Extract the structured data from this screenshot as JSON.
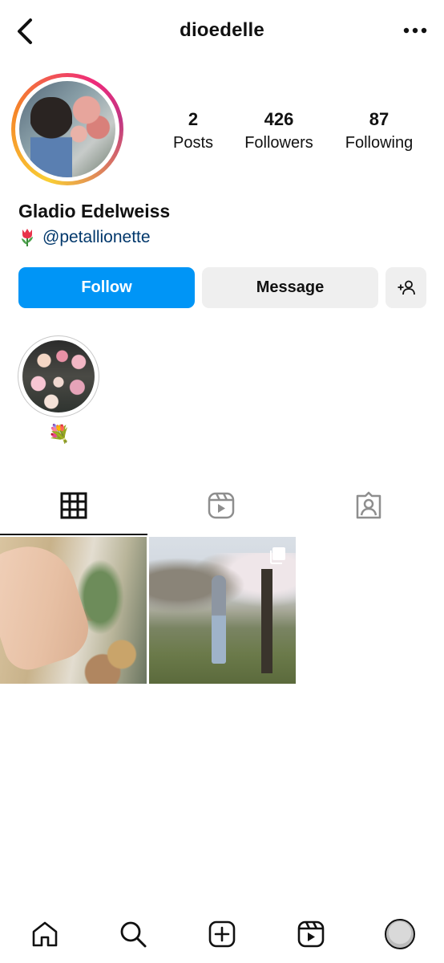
{
  "header": {
    "username": "dioedelle"
  },
  "profile": {
    "full_name": "Gladio Edelweiss",
    "handle": "@petallionette",
    "stats": [
      {
        "value": "2",
        "label": "Posts"
      },
      {
        "value": "426",
        "label": "Followers"
      },
      {
        "value": "87",
        "label": "Following"
      }
    ]
  },
  "actions": {
    "follow_label": "Follow",
    "message_label": "Message"
  },
  "highlights": [
    {
      "label": "💐"
    }
  ],
  "tabs": [
    {
      "name": "grid-icon",
      "active": true
    },
    {
      "name": "reels-icon",
      "active": false
    },
    {
      "name": "tagged-icon",
      "active": false
    }
  ],
  "posts": [
    {
      "subject": "hands arranging pink roses",
      "multi": false
    },
    {
      "subject": "person reaching toward cherry blossom tree",
      "multi": true
    }
  ],
  "bottom_nav": [
    {
      "name": "home-icon"
    },
    {
      "name": "search-icon"
    },
    {
      "name": "create-icon"
    },
    {
      "name": "reels-icon"
    },
    {
      "name": "profile-avatar"
    }
  ],
  "colors": {
    "primary": "#0095f6",
    "secondary_button": "#efefef",
    "link": "#00376b"
  }
}
